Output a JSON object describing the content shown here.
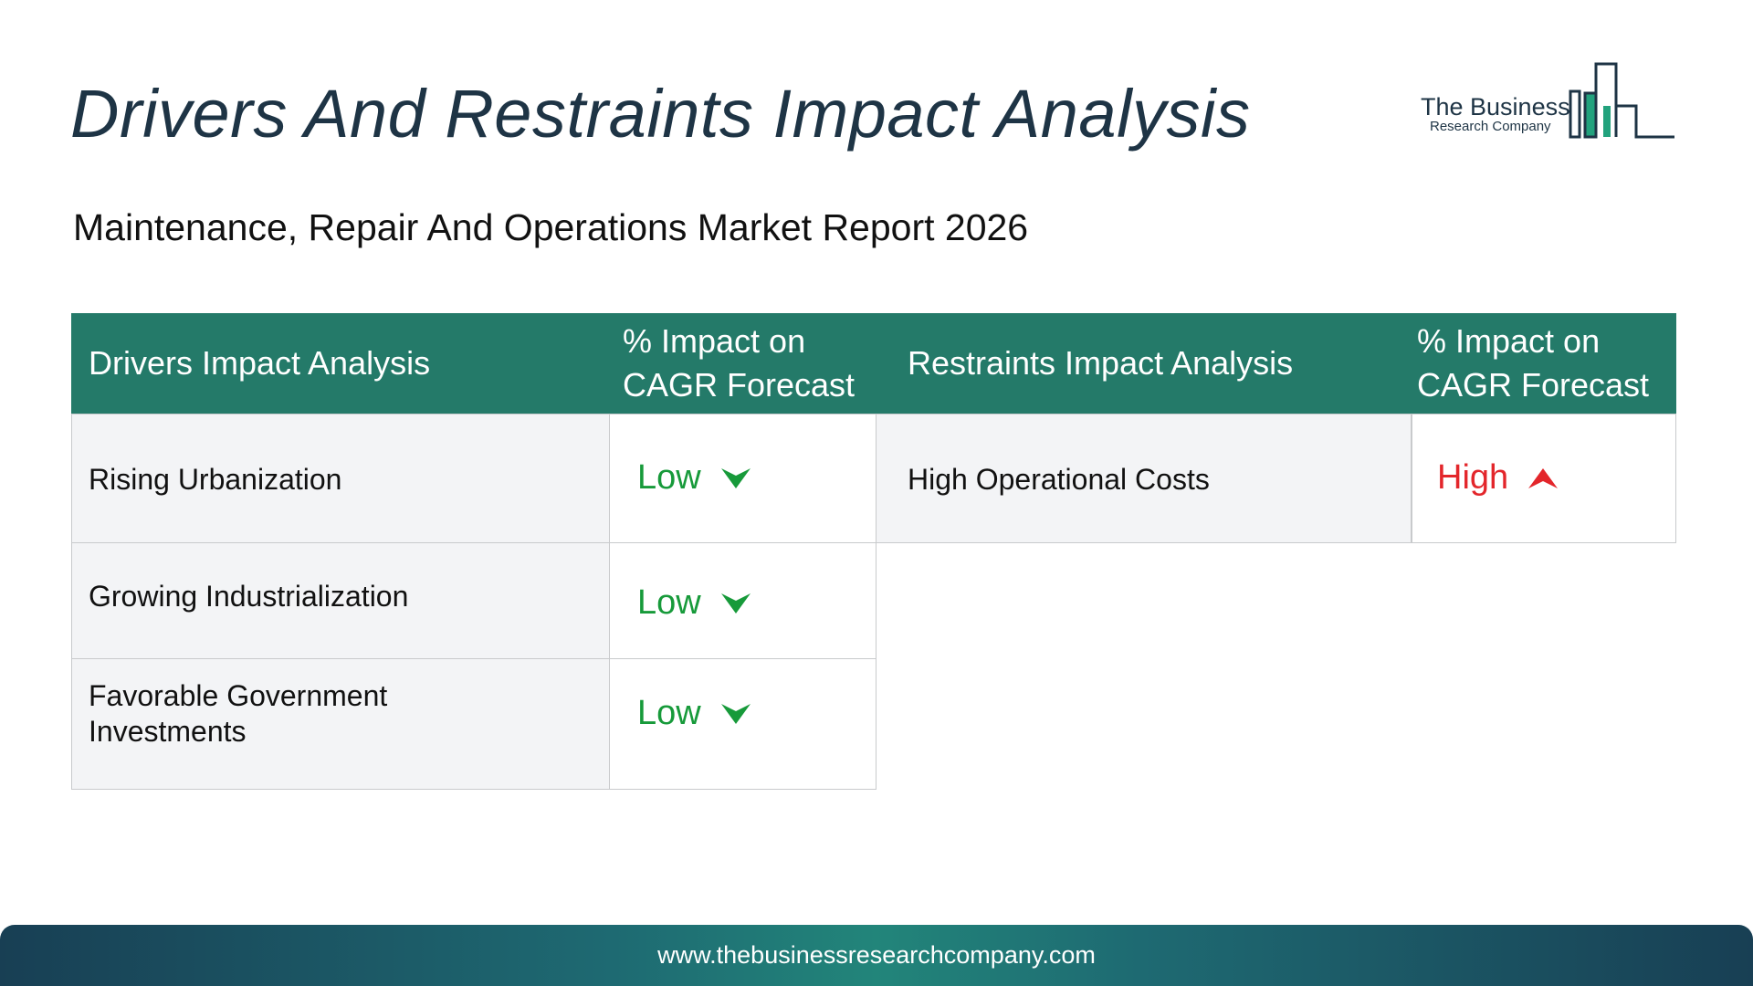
{
  "title": "Drivers And Restraints Impact Analysis",
  "subtitle": "Maintenance, Repair And Operations Market Report 2026",
  "logo": {
    "name": "The Business",
    "sub": "Research Company"
  },
  "table": {
    "headers": {
      "drivers": "Drivers Impact Analysis",
      "drivers_impact_line1": "% Impact on",
      "drivers_impact_line2": "CAGR Forecast",
      "restraints": "Restraints Impact Analysis",
      "restraints_impact_line1": "% Impact on",
      "restraints_impact_line2": "CAGR Forecast"
    },
    "drivers": [
      {
        "label_line1": "Rising Urbanization",
        "label_line2": "",
        "impact": "Low",
        "direction": "down"
      },
      {
        "label_line1": "Growing Industrialization",
        "label_line2": "",
        "impact": "Low",
        "direction": "down"
      },
      {
        "label_line1": "Favorable Government",
        "label_line2": "Investments",
        "impact": "Low",
        "direction": "down"
      }
    ],
    "restraints": [
      {
        "label": "High Operational Costs",
        "impact": "High",
        "direction": "up"
      }
    ]
  },
  "colors": {
    "header_bg": "#247a69",
    "low": "#179a3a",
    "high": "#e3262b",
    "title": "#1e3445"
  },
  "footer": {
    "url": "www.thebusinessresearchcompany.com"
  }
}
